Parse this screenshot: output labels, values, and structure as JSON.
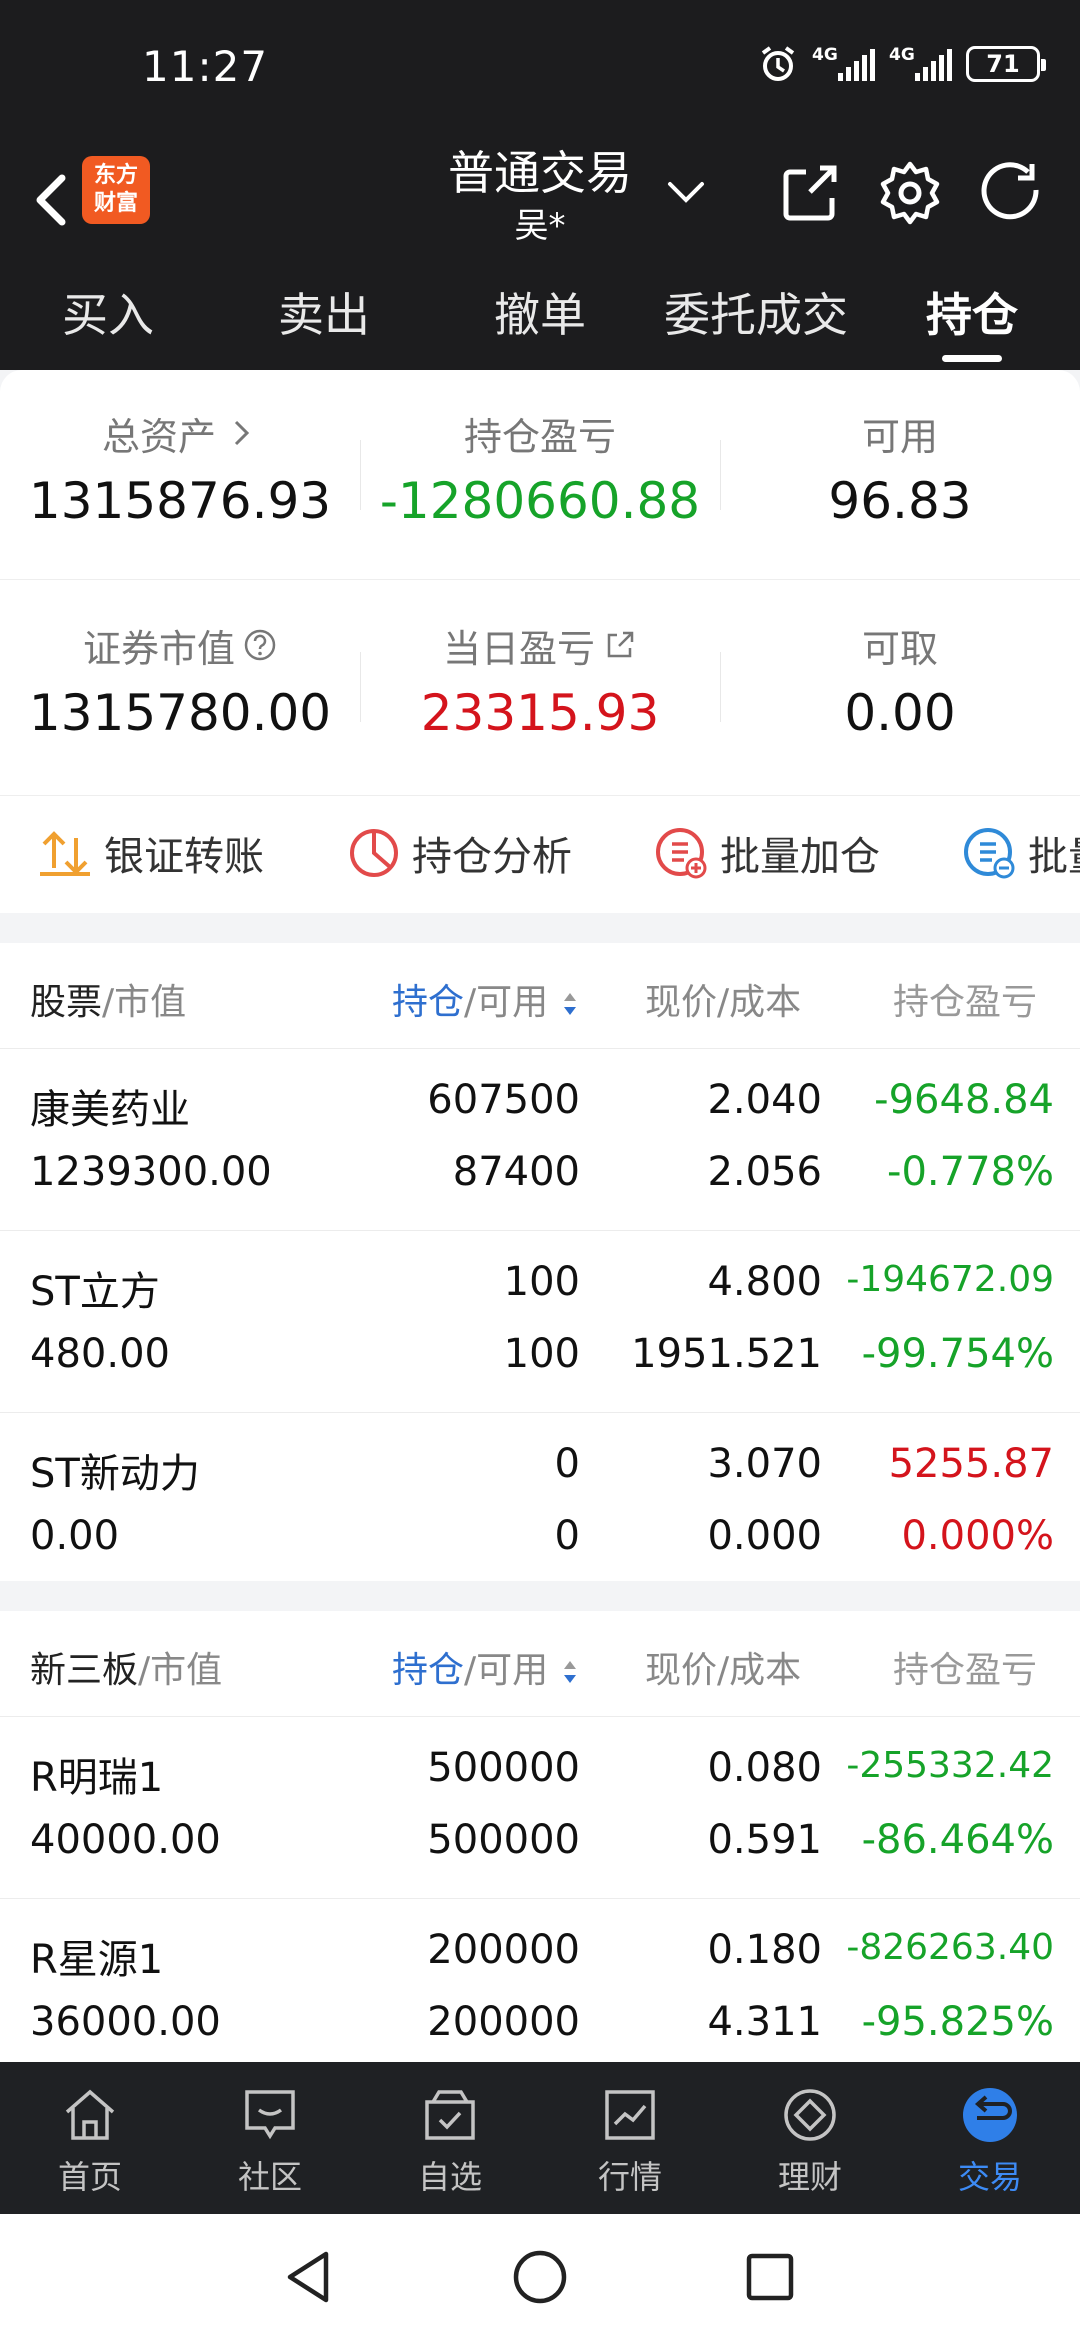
{
  "status": {
    "time": "11:27",
    "net1": "4G",
    "net2": "4G",
    "battery": "71"
  },
  "header": {
    "logo_line1": "东方",
    "logo_line2": "财富",
    "title": "普通交易",
    "subtitle": "吴*"
  },
  "tabs": [
    "买入",
    "卖出",
    "撤单",
    "委托成交",
    "持仓"
  ],
  "summary": {
    "total_assets_label": "总资产",
    "total_assets": "1315876.93",
    "position_pnl_label": "持仓盈亏",
    "position_pnl": "-1280660.88",
    "available_label": "可用",
    "available": "96.83",
    "market_value_label": "证券市值",
    "market_value": "1315780.00",
    "daily_pnl_label": "当日盈亏",
    "daily_pnl": "23315.93",
    "withdrawable_label": "可取",
    "withdrawable": "0.00"
  },
  "actions": [
    "银证转账",
    "持仓分析",
    "批量加仓",
    "批量"
  ],
  "stocks_section": {
    "h_name": "股票",
    "h_name_sub": "/市值",
    "h_hold": "持仓",
    "h_hold_sub": "/可用",
    "h_price": "现价/成本",
    "h_pnl": "持仓盈亏",
    "rows": [
      {
        "name": "康美药业",
        "value": "1239300.00",
        "hold": "607500",
        "avail": "87400",
        "price": "2.040",
        "cost": "2.056",
        "pnl": "-9648.84",
        "pct": "-0.778%"
      },
      {
        "name": "ST立方",
        "value": "480.00",
        "hold": "100",
        "avail": "100",
        "price": "4.800",
        "cost": "1951.521",
        "pnl": "-194672.09",
        "pct": "-99.754%"
      },
      {
        "name": "ST新动力",
        "value": "0.00",
        "hold": "0",
        "avail": "0",
        "price": "3.070",
        "cost": "0.000",
        "pnl": "5255.87",
        "pct": "0.000%"
      }
    ]
  },
  "neeq_section": {
    "h_name": "新三板",
    "h_name_sub": "/市值",
    "h_hold": "持仓",
    "h_hold_sub": "/可用",
    "h_price": "现价/成本",
    "h_pnl": "持仓盈亏",
    "rows": [
      {
        "name": "R明瑞1",
        "value": "40000.00",
        "hold": "500000",
        "avail": "500000",
        "price": "0.080",
        "cost": "0.591",
        "pnl": "-255332.42",
        "pct": "-86.464%"
      },
      {
        "name": "R星源1",
        "value": "36000.00",
        "hold": "200000",
        "avail": "200000",
        "price": "0.180",
        "cost": "4.311",
        "pnl": "-826263.40",
        "pct": "-95.825%"
      }
    ]
  },
  "bottom_nav": [
    "首页",
    "社区",
    "自选",
    "行情",
    "理财",
    "交易"
  ],
  "colors": {
    "gain": "#d4141c",
    "loss": "#16a329",
    "accent": "#2e6fcf",
    "active_nav": "#3d8bf5"
  }
}
